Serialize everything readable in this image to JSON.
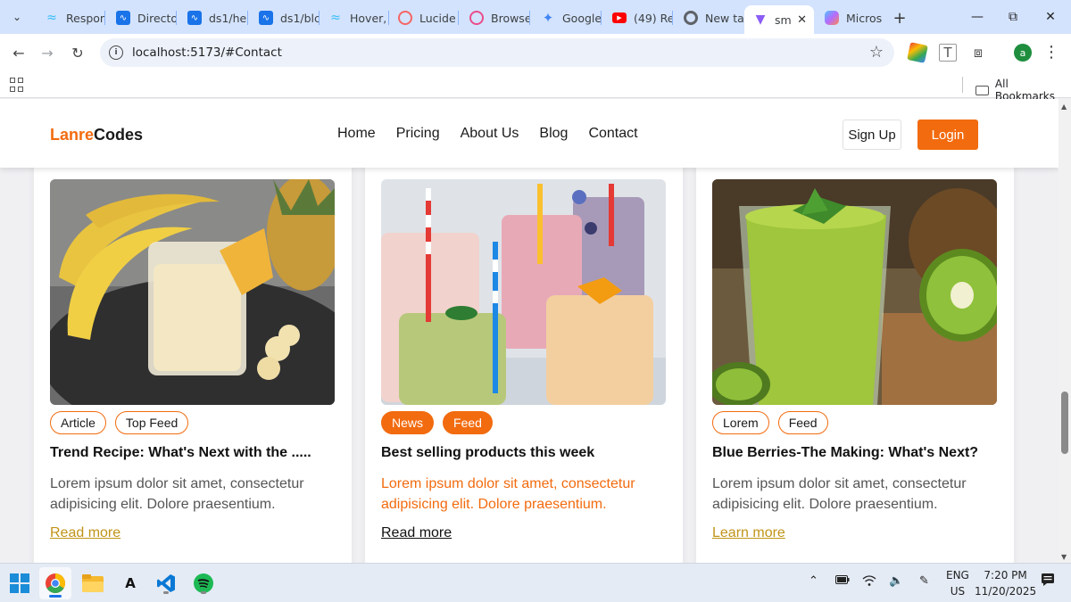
{
  "tabs": [
    {
      "label": "Respon",
      "icon": "tailwind-icon",
      "color": "#38bdf8"
    },
    {
      "label": "Directo",
      "icon": "ds1-icon",
      "color": "#1a73e8"
    },
    {
      "label": "ds1/he",
      "icon": "ds1-icon",
      "color": "#1a73e8"
    },
    {
      "label": "ds1/blc",
      "icon": "ds1-icon",
      "color": "#1a73e8"
    },
    {
      "label": "Hover,",
      "icon": "tailwind-icon",
      "color": "#38bdf8"
    },
    {
      "label": "Lucide",
      "icon": "lucide-icon",
      "color": "#f56565"
    },
    {
      "label": "Browse",
      "icon": "dribbble-icon",
      "color": "#ea4c89"
    },
    {
      "label": "Google",
      "icon": "gemini-icon",
      "color": "#4285f4"
    },
    {
      "label": "(49) Re",
      "icon": "youtube-icon",
      "color": "#ff0000"
    },
    {
      "label": "New ta",
      "icon": "chrome-icon",
      "color": "#5f6368"
    },
    {
      "label": "sm",
      "icon": "vite-icon",
      "color": "#8b5cf6"
    },
    {
      "label": "Micros",
      "icon": "copilot-icon",
      "color": "#7b61ff"
    }
  ],
  "address_bar": {
    "url": "localhost:5173/#Contact"
  },
  "profile_initial": "a",
  "bookmarks": {
    "all_label": "All Bookmarks"
  },
  "site": {
    "logo_part1": "Lanre",
    "logo_part2": "Codes",
    "nav": [
      "Home",
      "Pricing",
      "About Us",
      "Blog",
      "Contact"
    ],
    "signup_label": "Sign Up",
    "login_label": "Login",
    "accent_color": "#f26b0f"
  },
  "cards": [
    {
      "image": "banana-pineapple-smoothie",
      "tags": [
        "Article",
        "Top Feed"
      ],
      "tag_style": "outline",
      "title": "Trend Recipe: What's Next with the .....",
      "text": "Lorem ipsum dolor sit amet, consectetur adipisicing elit. Dolore praesentium.",
      "link": "Read more"
    },
    {
      "image": "fruit-smoothies-straws",
      "tags": [
        "News",
        "Feed"
      ],
      "tag_style": "filled",
      "title": "Best selling products this week",
      "text": "Lorem ipsum dolor sit amet, consectetur adipisicing elit. Dolore praesentium.",
      "link": "Read more"
    },
    {
      "image": "kiwi-smoothie",
      "tags": [
        "Lorem",
        "Feed"
      ],
      "tag_style": "outline",
      "title": "Blue Berries-The Making: What's Next?",
      "text": "Lorem ipsum dolor sit amet, consectetur adipisicing elit. Dolore praesentium.",
      "link": "Learn more"
    }
  ],
  "taskbar": {
    "language_line1": "ENG",
    "language_line2": "US",
    "time": "7:20 PM",
    "date": "11/20/2025"
  }
}
